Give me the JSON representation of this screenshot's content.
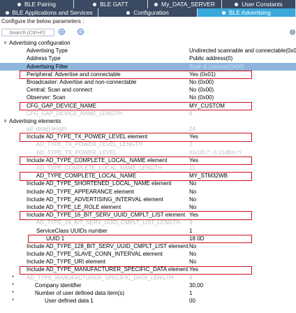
{
  "tabs_top": [
    {
      "label": "BLE Pairing"
    },
    {
      "label": "BLE GATT"
    },
    {
      "label": "My_DATA_SERVER"
    },
    {
      "label": "User Constants"
    }
  ],
  "tabs_second": [
    {
      "label": "BLE Applications and Services"
    },
    {
      "label": "Configuration"
    },
    {
      "label": "BLE Advertising"
    }
  ],
  "description": "Configure the below parameters :",
  "search": {
    "placeholder": "Search (Ctrl+F)"
  },
  "rows": [
    {
      "label": "Advertising configuration",
      "value": ""
    },
    {
      "label": "Advertising Type",
      "value": "Undirected scannable and connectable(0x00)"
    },
    {
      "label": "Address Type",
      "value": "Public address(0)"
    },
    {
      "label": "Advertising Filter",
      "value": "Scan & connect(0x00)"
    },
    {
      "label": "Peripheral: Advertise and connectable",
      "value": "Yes (0x01)"
    },
    {
      "label": "Broadcaster: Advertise and non-connectable",
      "value": "No (0x00)"
    },
    {
      "label": "Central: Scan and connect",
      "value": "No (0x00)"
    },
    {
      "label": "Observer: Scan",
      "value": "No (0x00)"
    },
    {
      "label": "CFG_GAP_DEVICE_NAME",
      "value": "MY_CUSTOM"
    },
    {
      "label": "CFG_GAP_DEVICE_NAME_LENGTH",
      "value": "9"
    },
    {
      "label": "Advertising elements",
      "value": ""
    },
    {
      "label": "ad_data[] length",
      "value": "24"
    },
    {
      "label": "Include AD_TYPE_TX_POWER_LEVEL element",
      "value": "Yes"
    },
    {
      "label": "AD_TYPE_TX_POWER_LEVEL_LENGTH",
      "value": "2"
    },
    {
      "label": "AD_TYPE_TX_POWER_LEVEL",
      "value": "(0x18) /* -0.15dBm */"
    },
    {
      "label": "Include AD_TYPE_COMPLETE_LOCAL_NAME element",
      "value": "Yes"
    },
    {
      "label": "AD_TYPE_COMPLETE_LOCAL_NAME_LENGTH",
      "value": "11"
    },
    {
      "label": "AD_TYPE_COMPLETE_LOCAL_NAME",
      "value": "MY_STM32WB"
    },
    {
      "label": "Include AD_TYPE_SHORTENED_LOCAL_NAME  element",
      "value": "No"
    },
    {
      "label": "Include AD_TYPE_APPEARANCE element",
      "value": "No"
    },
    {
      "label": "Include AD_TYPE_ADVERTISING_INTERVAL element",
      "value": "No"
    },
    {
      "label": "Include AD_TYPE_LE_ROLE element",
      "value": "No"
    },
    {
      "label": "Include AD_TYPE_16_BIT_SERV_UUID_CMPLT_LIST element",
      "value": "Yes"
    },
    {
      "label": "AD_TYPE_16_BIT_SERV_UUID_CMPLT_LIST_LENGTH",
      "value": "3"
    },
    {
      "label": "ServiceClass UUIDs number",
      "value": "1"
    },
    {
      "label": "UUID 1",
      "value": "18 0D"
    },
    {
      "label": "Include AD_TYPE_128_BIT_SERV_UUID_CMPLT_LIST element",
      "value": "No"
    },
    {
      "label": "Include AD_TYPE_SLAVE_CONN_INTERVAL element",
      "value": "No"
    },
    {
      "label": "Include AD_TYPE_URI element",
      "value": "No"
    },
    {
      "label": "Include AD_TYPE_MANUFACTURER_SPECIFIC_DATA element",
      "value": "Yes"
    },
    {
      "label": "AD_TYPE_MANUFACTURER_SPECIFIC_DATA_LENGTH",
      "value": "4"
    },
    {
      "label": "Company identifier",
      "value": "30,00"
    },
    {
      "label": "Number of user defined data item(s)",
      "value": "1"
    },
    {
      "label": "User defined data 1",
      "value": "00"
    }
  ],
  "icons": {
    "search": "search-icon",
    "expand": "expand-icon",
    "collapse": "collapse-icon",
    "info": "info-icon"
  },
  "colors": {
    "tab_bg": "#3a4a63",
    "tab_active": "#39a9dc",
    "selection": "#8fb5dc",
    "highlight": "#d0101a"
  }
}
